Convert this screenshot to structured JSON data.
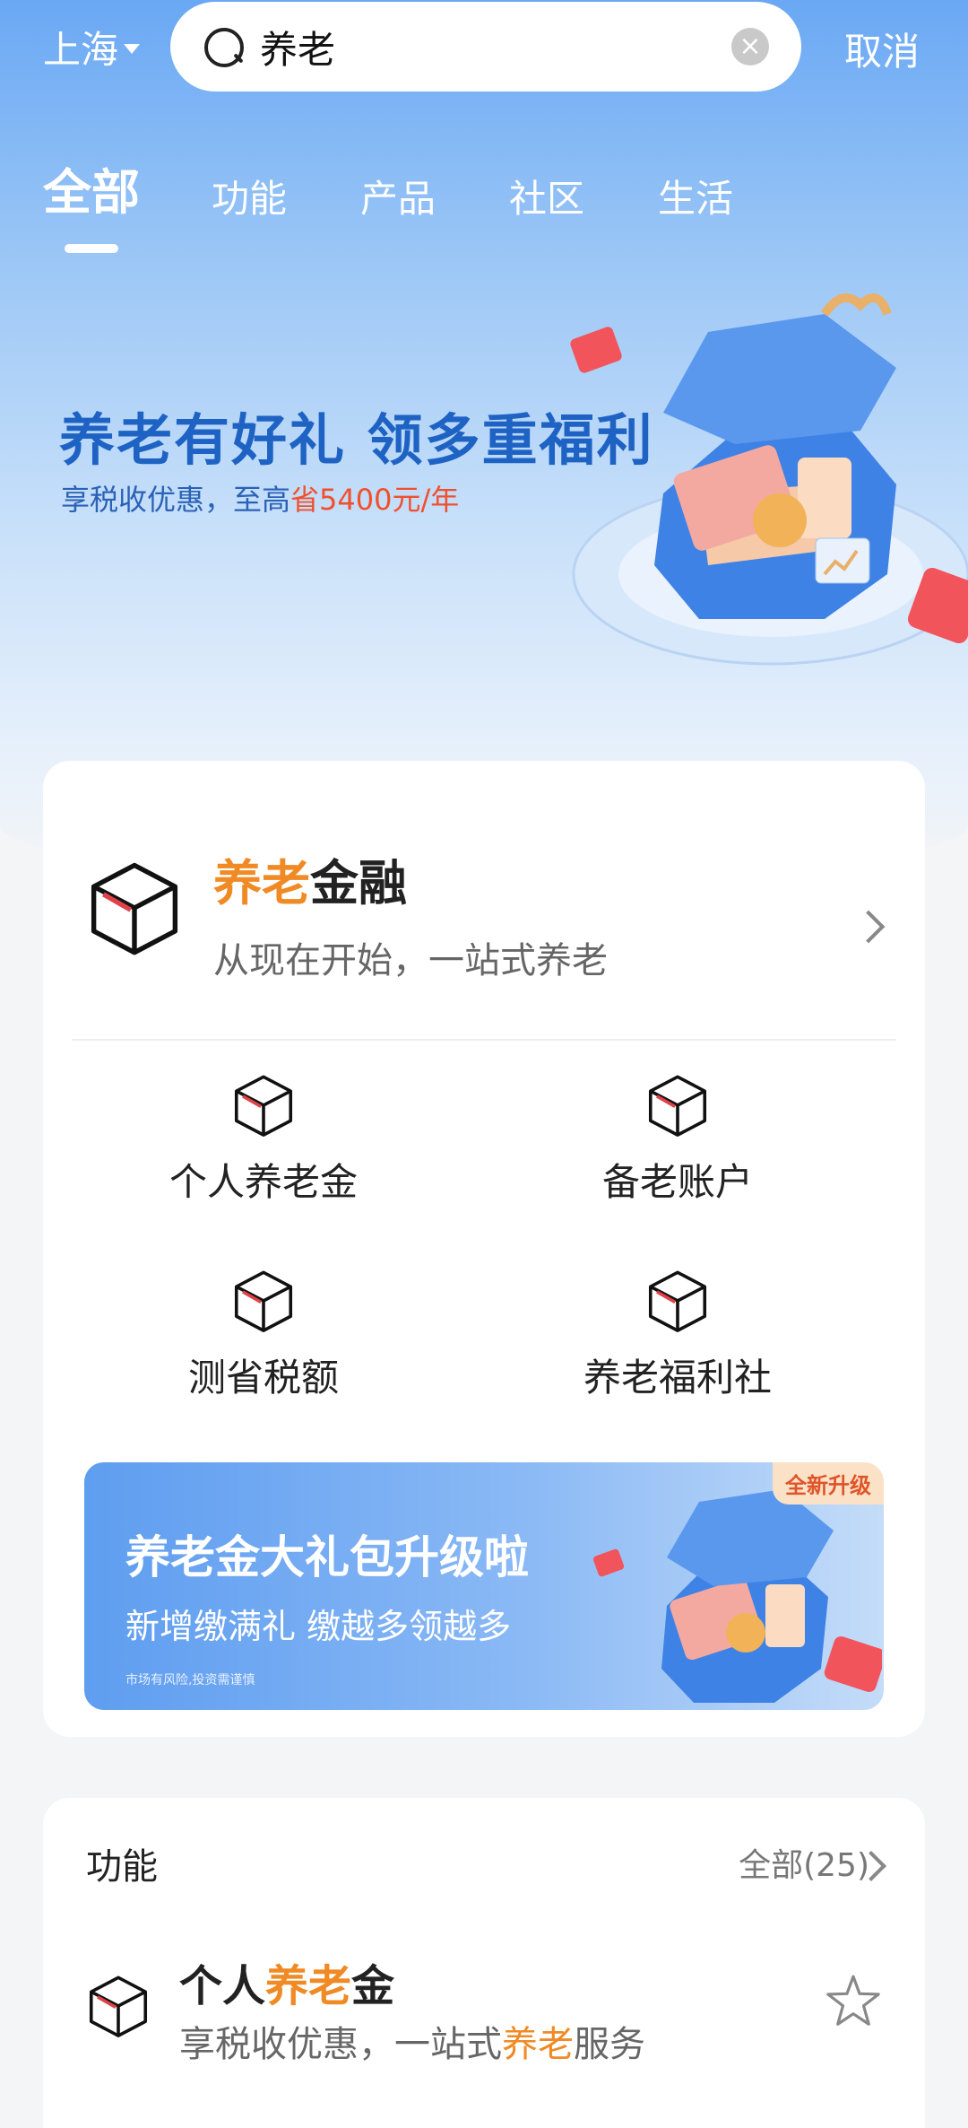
{
  "header": {
    "city": "上海",
    "search_query": "养老",
    "clear_icon": "close-circle-icon",
    "cancel_label": "取消"
  },
  "tabs": [
    {
      "label": "全部",
      "active": true
    },
    {
      "label": "功能",
      "active": false
    },
    {
      "label": "产品",
      "active": false
    },
    {
      "label": "社区",
      "active": false
    },
    {
      "label": "生活",
      "active": false
    }
  ],
  "hero": {
    "title": "养老有好礼 领多重福利",
    "subtitle_prefix": "享税收优惠，至高",
    "subtitle_highlight": "省5400元/年"
  },
  "finance_card": {
    "title_highlight": "养老",
    "title_rest": "金融",
    "subtitle": "从现在开始，一站式养老",
    "items": [
      {
        "label": "个人养老金",
        "icon": "cube-icon"
      },
      {
        "label": "备老账户",
        "icon": "cube-icon"
      },
      {
        "label": "测省税额",
        "icon": "cube-icon"
      },
      {
        "label": "养老福利社",
        "icon": "cube-icon"
      }
    ],
    "promo": {
      "badge": "全新升级",
      "title": "养老金大礼包升级啦",
      "subtitle": "新增缴满礼  缴越多领越多",
      "note": "市场有风险,投资需谨慎"
    }
  },
  "functions": {
    "title": "功能",
    "all_label": "全部(25)",
    "items": [
      {
        "title_pre": "个人",
        "title_highlight": "养老",
        "title_post": "金",
        "sub_pre": "享税收优惠，一站式",
        "sub_highlight": "养老",
        "sub_post": "服务",
        "favorite_icon": "star-outline-icon"
      }
    ]
  },
  "colors": {
    "accent_orange": "#f08a24",
    "hero_blue": "#1e63c4",
    "highlight_red": "#f0502d"
  }
}
